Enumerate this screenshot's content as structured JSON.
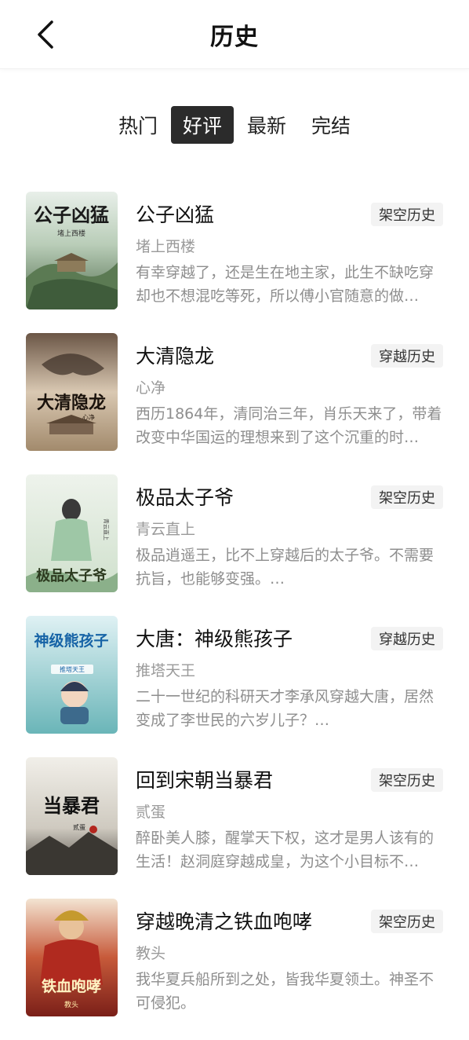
{
  "header": {
    "title": "历史",
    "back_icon": "chevron-left-icon"
  },
  "tabs": [
    {
      "label": "热门",
      "active": false
    },
    {
      "label": "好评",
      "active": true
    },
    {
      "label": "最新",
      "active": false
    },
    {
      "label": "完结",
      "active": false
    }
  ],
  "colors": {
    "active_tab_bg": "#2b2b2b",
    "tag_bg": "#f3f3f3",
    "muted_text": "#9a9a9a"
  },
  "books": [
    {
      "title": "公子凶猛",
      "tag": "架空历史",
      "author": "堵上西楼",
      "desc": "有幸穿越了，还是生在地主家，此生不缺吃穿却也不想混吃等死，所以傅小官随意的做…",
      "cover_text": "公子凶猛",
      "cover_author": "堵上西楼"
    },
    {
      "title": "大清隐龙",
      "tag": "穿越历史",
      "author": "心净",
      "desc": "西历1864年，清同治三年，肖乐天来了，带着改变中华国运的理想来到了这个沉重的时…",
      "cover_text": "大清隐龙",
      "cover_author": "心净"
    },
    {
      "title": "极品太子爷",
      "tag": "架空历史",
      "author": "青云直上",
      "desc": "极品逍遥王，比不上穿越后的太子爷。不需要抗旨，也能够变强。…",
      "cover_text": "极品太子爷",
      "cover_author": "青云直上"
    },
    {
      "title": "大唐：神级熊孩子",
      "tag": "穿越历史",
      "author": "推塔天王",
      "desc": "二十一世纪的科研天才李承风穿越大唐，居然变成了李世民的六岁儿子？…",
      "cover_text": "神级熊孩子",
      "cover_author": "推塔天王"
    },
    {
      "title": "回到宋朝当暴君",
      "tag": "架空历史",
      "author": "贰蛋",
      "desc": "醉卧美人膝，醒掌天下权，这才是男人该有的生活！赵洞庭穿越成皇，为这个小目标不…",
      "cover_text": "当暴君",
      "cover_author": "贰蛋"
    },
    {
      "title": "穿越晚清之铁血咆哮",
      "tag": "架空历史",
      "author": "教头",
      "desc": "我华夏兵船所到之处，皆我华夏领土。神圣不可侵犯。",
      "cover_text": "铁血咆哮",
      "cover_author": "教头"
    }
  ]
}
